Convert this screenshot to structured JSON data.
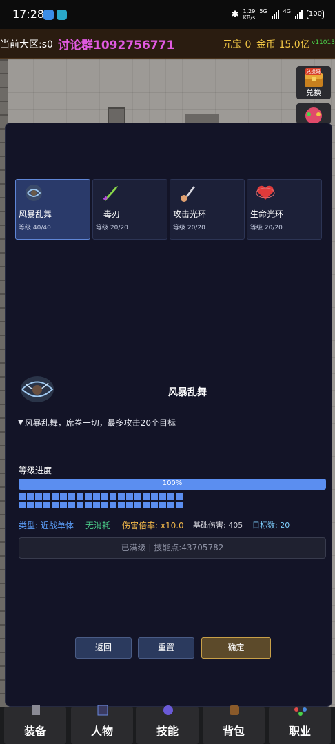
{
  "status_bar": {
    "time": "17:28",
    "net_speed_value": "1.29",
    "net_speed_unit": "KB/s",
    "signal1": "5G",
    "signal2": "4G",
    "battery": "100"
  },
  "game_header": {
    "region": "当前大区:s0",
    "group": "讨论群1092756771",
    "yuanbao": "元宝 0",
    "gold": "金币 15.0亿",
    "version": "v11013"
  },
  "side_buttons": {
    "exchange_label": "兑换",
    "exchange_badge": "兑换码"
  },
  "skills": [
    {
      "name": "风暴乱舞",
      "level": "等级 40/40",
      "icon": "storm-icon",
      "selected": true
    },
    {
      "name": "毒刃",
      "level": "等级 20/20",
      "icon": "poison-blade-icon",
      "selected": false
    },
    {
      "name": "攻击光环",
      "level": "等级 20/20",
      "icon": "sword-arm-icon",
      "selected": false
    },
    {
      "name": "生命光环",
      "level": "等级 20/20",
      "icon": "heart-icon",
      "selected": false
    }
  ],
  "detail": {
    "name": "风暴乱舞",
    "description": "风暴乱舞，席卷一切，最多攻击20个目标",
    "level_title": "等级进度",
    "progress_label": "100%",
    "progress_value": 100,
    "segments_filled": 40,
    "type": "类型: 近战单体",
    "cost": "无消耗",
    "multiplier": "伤害倍率: x10.0",
    "base_damage": "基础伤害: 405",
    "targets": "目标数: 20",
    "max_text": "已满级 | 技能点:43705782"
  },
  "buttons": {
    "back": "返回",
    "reset": "重置",
    "confirm": "确定"
  },
  "bottom_nav": [
    {
      "label": "装备",
      "icon": "armor-icon"
    },
    {
      "label": "人物",
      "icon": "character-icon"
    },
    {
      "label": "技能",
      "icon": "skill-icon"
    },
    {
      "label": "背包",
      "icon": "backpack-icon"
    },
    {
      "label": "职业",
      "icon": "class-icon"
    }
  ],
  "colors": {
    "accent_blue": "#5b8ef0",
    "type_color": "#5b9cf5",
    "cost_color": "#4cd28c",
    "multiplier_color": "#f2b84a",
    "base_damage_color": "#d0d0d8",
    "targets_color": "#7fd0ff",
    "group_color": "#e05ae0",
    "gold_color": "#f2c744"
  }
}
